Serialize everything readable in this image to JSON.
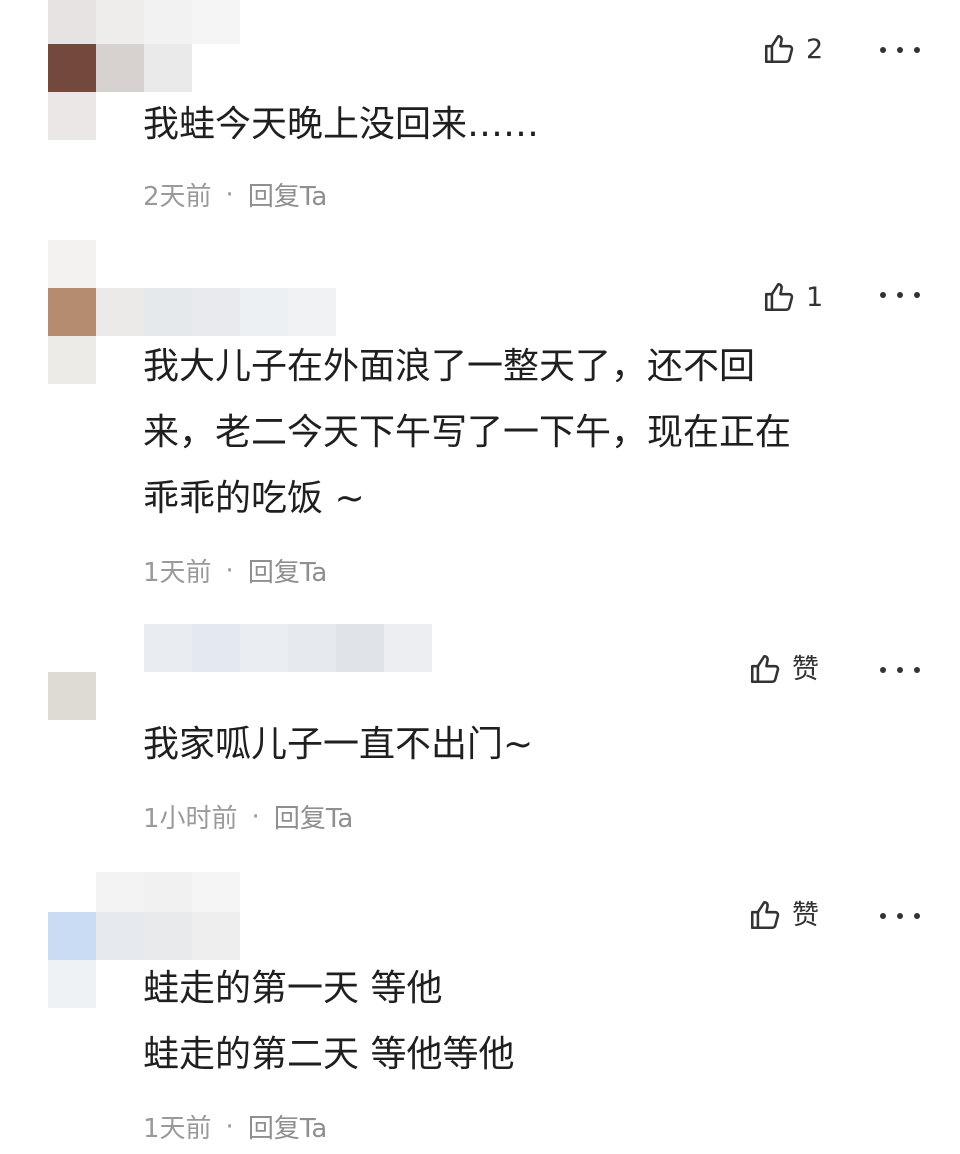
{
  "comments": [
    {
      "likes": "2",
      "lines": [
        "我蛙今天晚上没回来……"
      ],
      "time": "2天前",
      "separator": "·",
      "reply": "回复Ta"
    },
    {
      "likes": "1",
      "lines": [
        "我大儿子在外面浪了一整天了，还不回",
        "来，老二今天下午写了一下午，现在正在",
        "乖乖的吃饭 ~"
      ],
      "time": "1天前",
      "separator": "·",
      "reply": "回复Ta"
    },
    {
      "likes": "赞",
      "lines": [
        "我家呱儿子一直不出门~"
      ],
      "time": "1小时前",
      "separator": "·",
      "reply": "回复Ta"
    },
    {
      "likes": "赞",
      "lines": [
        "蛙走的第一天 等他",
        "蛙走的第二天 等他等他"
      ],
      "time": "1天前",
      "separator": "·",
      "reply": "回复Ta"
    }
  ],
  "icons": {
    "like": "thumbs-up-icon",
    "more": "more-dots-icon"
  },
  "colors": {
    "text": "#1f1f1f",
    "meta": "#9a9a9a",
    "icon": "#333333"
  }
}
